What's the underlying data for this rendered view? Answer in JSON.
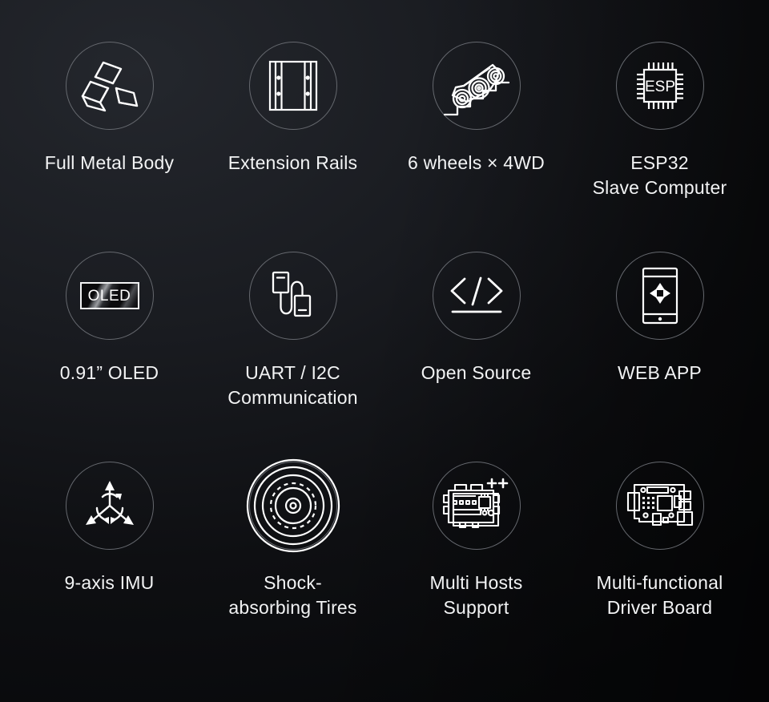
{
  "page": {
    "background_top_left": "#24272d",
    "background_bottom_right": "#0a0b0d",
    "circle_border_color": "#65686e",
    "icon_stroke_color": "#ffffff",
    "label_color": "#f2f3f4",
    "columns": 4,
    "rows": 3
  },
  "features": [
    {
      "icon": "gold-bars-icon",
      "label": "Full Metal Body"
    },
    {
      "icon": "extension-rails-icon",
      "label": "Extension Rails"
    },
    {
      "icon": "tracked-vehicle-stairs-icon",
      "label": "6 wheels × 4WD"
    },
    {
      "icon": "esp-chip-icon",
      "label": "ESP32\nSlave Computer"
    },
    {
      "icon": "oled-screen-icon",
      "label": "0.91” OLED"
    },
    {
      "icon": "cable-connector-icon",
      "label": "UART / I2C\nCommunication"
    },
    {
      "icon": "code-brackets-icon",
      "label": "Open Source"
    },
    {
      "icon": "phone-dpad-icon",
      "label": "WEB APP"
    },
    {
      "icon": "three-axis-gyro-icon",
      "label": "9-axis IMU"
    },
    {
      "icon": "tire-wheel-icon",
      "label": "Shock-\nabsorbing Tires"
    },
    {
      "icon": "stacked-boards-icon",
      "label": "Multi Hosts\nSupport"
    },
    {
      "icon": "driver-board-icon",
      "label": "Multi-functional\nDriver Board"
    }
  ],
  "icon_text": {
    "esp_chip": "ESP",
    "oled_screen": "OLED",
    "multi_hosts_plus": "++"
  }
}
